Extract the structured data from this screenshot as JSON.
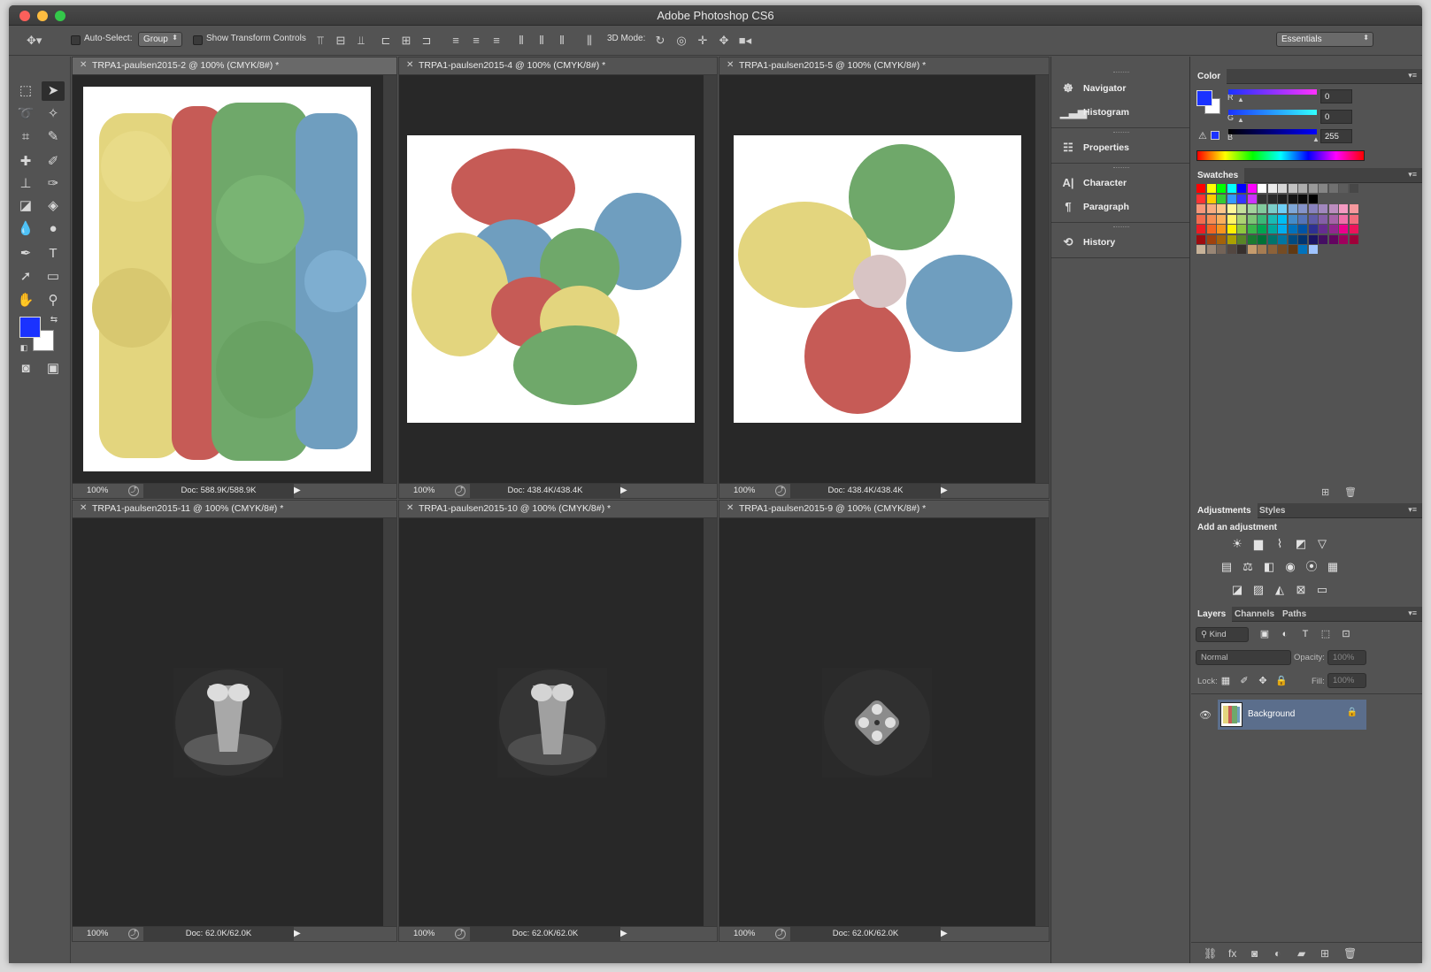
{
  "app": {
    "title": "Adobe Photoshop CS6"
  },
  "options": {
    "auto_select_label": "Auto-Select:",
    "auto_select_value": "Group",
    "show_transform_label": "Show Transform Controls",
    "mode_3d_label": "3D Mode:",
    "workspace": "Essentials"
  },
  "documents": [
    {
      "title": "TRPA1-paulsen2015-2 @ 100% (CMYK/8#) *",
      "zoom": "100%",
      "doc": "Doc: 588.9K/588.9K"
    },
    {
      "title": "TRPA1-paulsen2015-4 @ 100% (CMYK/8#) *",
      "zoom": "100%",
      "doc": "Doc: 438.4K/438.4K"
    },
    {
      "title": "TRPA1-paulsen2015-5 @ 100% (CMYK/8#) *",
      "zoom": "100%",
      "doc": "Doc: 438.4K/438.4K"
    },
    {
      "title": "TRPA1-paulsen2015-11 @ 100% (CMYK/8#) *",
      "zoom": "100%",
      "doc": "Doc: 62.0K/62.0K"
    },
    {
      "title": "TRPA1-paulsen2015-10 @ 100% (CMYK/8#) *",
      "zoom": "100%",
      "doc": "Doc: 62.0K/62.0K"
    },
    {
      "title": "TRPA1-paulsen2015-9 @ 100% (CMYK/8#) *",
      "zoom": "100%",
      "doc": "Doc: 62.0K/62.0K"
    }
  ],
  "mid_panel": {
    "navigator": "Navigator",
    "histogram": "Histogram",
    "properties": "Properties",
    "character": "Character",
    "paragraph": "Paragraph",
    "history": "History"
  },
  "color_panel": {
    "tab": "Color",
    "r_label": "R",
    "r_value": "0",
    "g_label": "G",
    "g_value": "0",
    "b_label": "B",
    "b_value": "255",
    "foreground": "#1a32ff",
    "background": "#ffffff"
  },
  "swatches_panel": {
    "tab": "Swatches"
  },
  "adjustments_panel": {
    "tab": "Adjustments",
    "tab2": "Styles",
    "heading": "Add an adjustment"
  },
  "layers_panel": {
    "tab": "Layers",
    "tab2": "Channels",
    "tab3": "Paths",
    "kind": "Kind",
    "blend_mode": "Normal",
    "opacity_label": "Opacity:",
    "opacity_value": "100%",
    "lock_label": "Lock:",
    "fill_label": "Fill:",
    "fill_value": "100%",
    "layer_name": "Background"
  }
}
